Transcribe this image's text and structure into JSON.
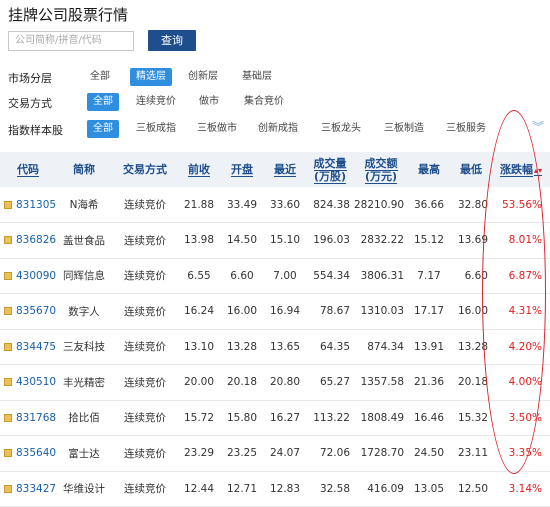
{
  "title": "挂牌公司股票行情",
  "search": {
    "placeholder": "公司简称/拼音/代码",
    "button_label": "查询"
  },
  "filters": {
    "market": {
      "label": "市场分层",
      "options": [
        "全部",
        "精选层",
        "创新层",
        "基础层"
      ],
      "selected": "精选层"
    },
    "trade": {
      "label": "交易方式",
      "options": [
        "全部",
        "连续竞价",
        "做市",
        "集合竞价"
      ],
      "selected": "全部"
    },
    "index": {
      "label": "指数样本股",
      "options": [
        "全部",
        "三板成指",
        "三板做市",
        "创新成指",
        "三板龙头",
        "三板制造",
        "三板服务"
      ],
      "selected": "全部"
    }
  },
  "icons": {
    "expand": "chevron-down-icon",
    "stock": "stock-square-icon"
  },
  "colors": {
    "accent": "#2f8ee0",
    "header_text": "#1f4e8c",
    "up": "#e02020",
    "circle": "#d8242a"
  },
  "table": {
    "headers": [
      "代码",
      "简称",
      "交易方式",
      "前收",
      "开盘",
      "最近",
      "成交量\n(万股)",
      "成交额\n(万元)",
      "最高",
      "最低",
      "涨跌幅"
    ],
    "rows": [
      [
        "831305",
        "N海希",
        "连续竞价",
        "21.88",
        "33.49",
        "33.60",
        "824.38",
        "28210.90",
        "36.66",
        "32.80",
        "53.56%"
      ],
      [
        "836826",
        "盖世食品",
        "连续竞价",
        "13.98",
        "14.50",
        "15.10",
        "196.03",
        "2832.22",
        "15.12",
        "13.69",
        "8.01%"
      ],
      [
        "430090",
        "同辉信息",
        "连续竞价",
        "6.55",
        "6.60",
        "7.00",
        "554.34",
        "3806.31",
        "7.17",
        "6.60",
        "6.87%"
      ],
      [
        "835670",
        "数字人",
        "连续竞价",
        "16.24",
        "16.00",
        "16.94",
        "78.67",
        "1310.03",
        "17.17",
        "16.00",
        "4.31%"
      ],
      [
        "834475",
        "三友科技",
        "连续竞价",
        "13.10",
        "13.28",
        "13.65",
        "64.35",
        "874.34",
        "13.91",
        "13.28",
        "4.20%"
      ],
      [
        "430510",
        "丰光精密",
        "连续竞价",
        "20.00",
        "20.18",
        "20.80",
        "65.27",
        "1357.58",
        "21.36",
        "20.18",
        "4.00%"
      ],
      [
        "831768",
        "拾比佰",
        "连续竞价",
        "15.72",
        "15.80",
        "16.27",
        "113.22",
        "1808.49",
        "16.46",
        "15.32",
        "3.50%"
      ],
      [
        "835640",
        "富士达",
        "连续竞价",
        "23.29",
        "23.25",
        "24.07",
        "72.06",
        "1728.70",
        "24.50",
        "23.11",
        "3.35%"
      ],
      [
        "833427",
        "华维设计",
        "连续竞价",
        "12.44",
        "12.71",
        "12.83",
        "32.58",
        "416.09",
        "13.05",
        "12.50",
        "3.14%"
      ]
    ]
  }
}
